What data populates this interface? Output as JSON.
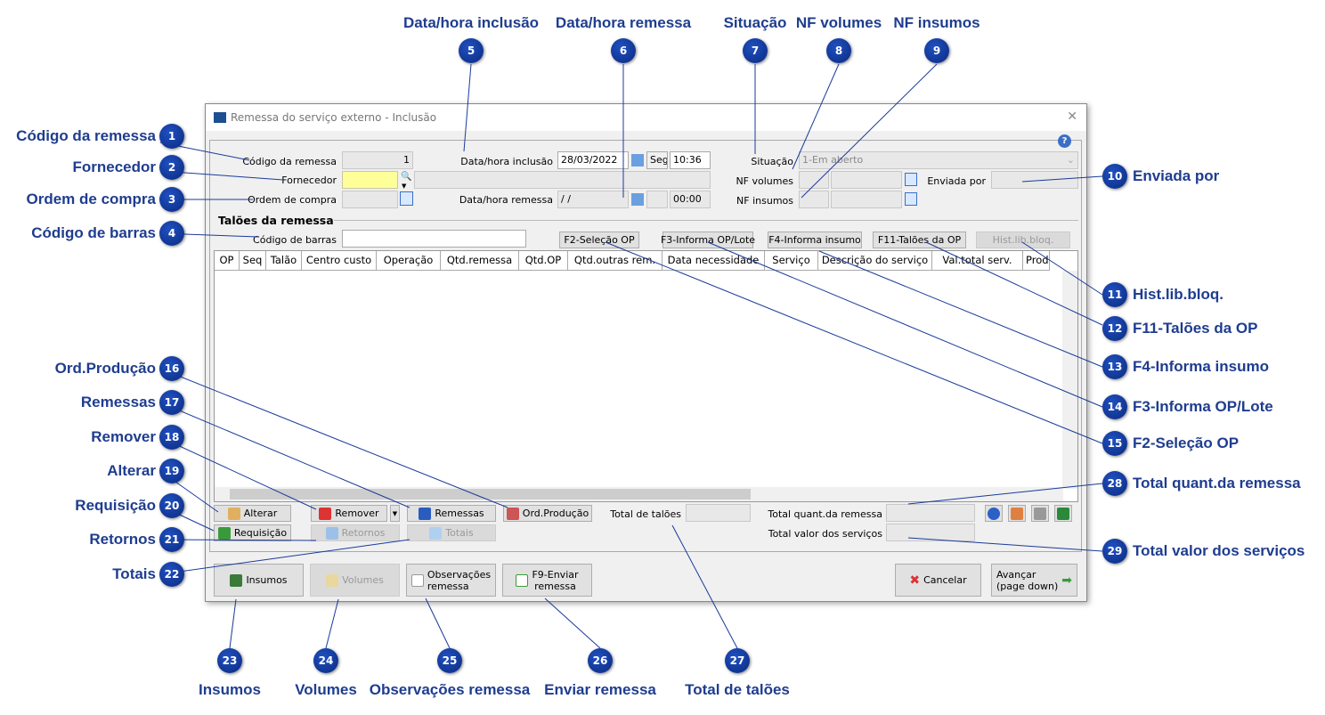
{
  "window": {
    "title": "Remessa do serviço externo - Inclusão",
    "close": "✕"
  },
  "form": {
    "codigo_remessa": {
      "label": "Código da remessa",
      "value": "1"
    },
    "fornecedor": {
      "label": "Fornecedor",
      "value": "",
      "name": ""
    },
    "ordem_compra": {
      "label": "Ordem de compra",
      "value": ""
    },
    "data_inclusao": {
      "label": "Data/hora inclusão",
      "date": "28/03/2022",
      "weekday": "Seg",
      "time": "10:36"
    },
    "data_remessa": {
      "label": "Data/hora remessa",
      "date": " /  /",
      "weekday": "",
      "time": "00:00"
    },
    "situacao": {
      "label": "Situação",
      "value": "1-Em aberto"
    },
    "nf_volumes": {
      "label": "NF volumes"
    },
    "nf_insumos": {
      "label": "NF insumos"
    },
    "enviada_por": {
      "label": "Enviada por",
      "value": ""
    }
  },
  "taloes": {
    "title": "Talões da remessa",
    "barcode_label": "Código de barras",
    "barcode_value": "",
    "buttons": [
      "F2-Seleção OP",
      "F3-Informa OP/Lote",
      "F4-Informa insumo",
      "F11-Talões da OP",
      "Hist.lib.bloq."
    ],
    "columns": [
      "OP",
      "Seq",
      "Talão",
      "Centro custo",
      "Operação",
      "Qtd.remessa",
      "Qtd.OP",
      "Qtd.outras rem.",
      "Data necessidade",
      "Serviço",
      "Descrição do serviço",
      "Val.total serv.",
      "Prod"
    ]
  },
  "row_buttons": {
    "alterar": "Alterar",
    "remover": "Remover",
    "remessas": "Remessas",
    "ord_producao": "Ord.Produção",
    "requisicao": "Requisição",
    "retornos": "Retornos",
    "totais": "Totais"
  },
  "totals": {
    "total_taloes": "Total de talões",
    "total_quant": "Total quant.da remessa",
    "total_valor": "Total valor dos serviços"
  },
  "bottom_buttons": {
    "insumos": "Insumos",
    "volumes": "Volumes",
    "observacoes": "Observações\nremessa",
    "enviar": "F9-Enviar\nremessa",
    "cancelar": "Cancelar",
    "avancar": "Avançar\n(page down)"
  },
  "callouts": [
    {
      "n": "1",
      "label": "Código da remessa"
    },
    {
      "n": "2",
      "label": "Fornecedor"
    },
    {
      "n": "3",
      "label": "Ordem de compra"
    },
    {
      "n": "4",
      "label": "Código de barras"
    },
    {
      "n": "5",
      "label": "Data/hora inclusão"
    },
    {
      "n": "6",
      "label": "Data/hora remessa"
    },
    {
      "n": "7",
      "label": "Situação"
    },
    {
      "n": "8",
      "label": "NF volumes"
    },
    {
      "n": "9",
      "label": "NF insumos"
    },
    {
      "n": "10",
      "label": "Enviada por"
    },
    {
      "n": "11",
      "label": "Hist.lib.bloq."
    },
    {
      "n": "12",
      "label": "F11-Talões da OP"
    },
    {
      "n": "13",
      "label": "F4-Informa insumo"
    },
    {
      "n": "14",
      "label": "F3-Informa OP/Lote"
    },
    {
      "n": "15",
      "label": "F2-Seleção OP"
    },
    {
      "n": "16",
      "label": "Ord.Produção"
    },
    {
      "n": "17",
      "label": "Remessas"
    },
    {
      "n": "18",
      "label": "Remover"
    },
    {
      "n": "19",
      "label": "Alterar"
    },
    {
      "n": "20",
      "label": "Requisição"
    },
    {
      "n": "21",
      "label": "Retornos"
    },
    {
      "n": "22",
      "label": "Totais"
    },
    {
      "n": "23",
      "label": "Insumos"
    },
    {
      "n": "24",
      "label": "Volumes"
    },
    {
      "n": "25",
      "label": "Observações remessa"
    },
    {
      "n": "26",
      "label": "Enviar remessa"
    },
    {
      "n": "27",
      "label": "Total de talões"
    },
    {
      "n": "28",
      "label": "Total quant.da remessa"
    },
    {
      "n": "29",
      "label": "Total valor dos serviços"
    }
  ],
  "colors": {
    "callout": "#0a2a80",
    "callout_label": "#1f3d8f",
    "leader": "#1a3a9a",
    "required_field": "#ffff99"
  }
}
